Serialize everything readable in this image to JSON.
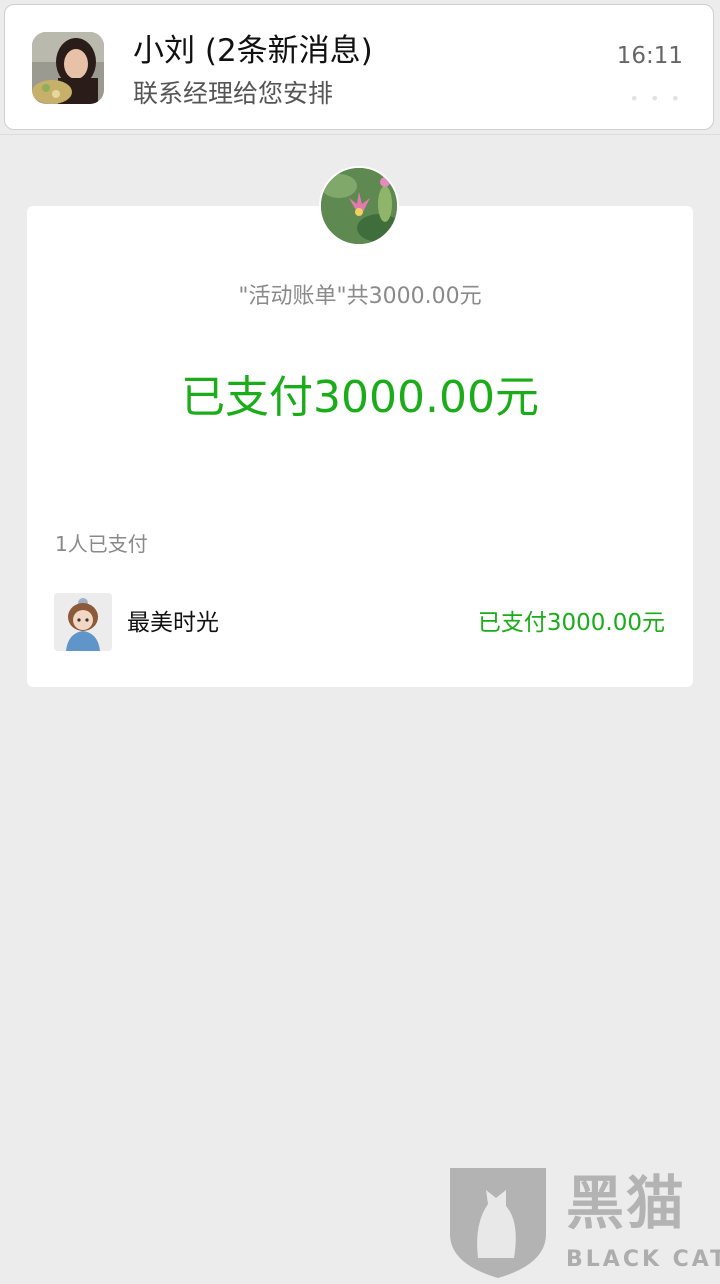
{
  "notification": {
    "title": "小刘 (2条新消息)",
    "message": "联系经理给您安排",
    "time": "16:11",
    "more": "• • •"
  },
  "bill": {
    "total_text": "\"活动账单\"共3000.00元",
    "paid_text": "已支付3000.00元",
    "paid_count": "1人已支付",
    "payers": [
      {
        "name": "最美时光",
        "status": "已支付3000.00元"
      }
    ]
  },
  "watermark": {
    "text": "黑猫",
    "sub": "BLACK CAT"
  },
  "colors": {
    "paid_green": "#1aad19",
    "background": "#ececec"
  }
}
